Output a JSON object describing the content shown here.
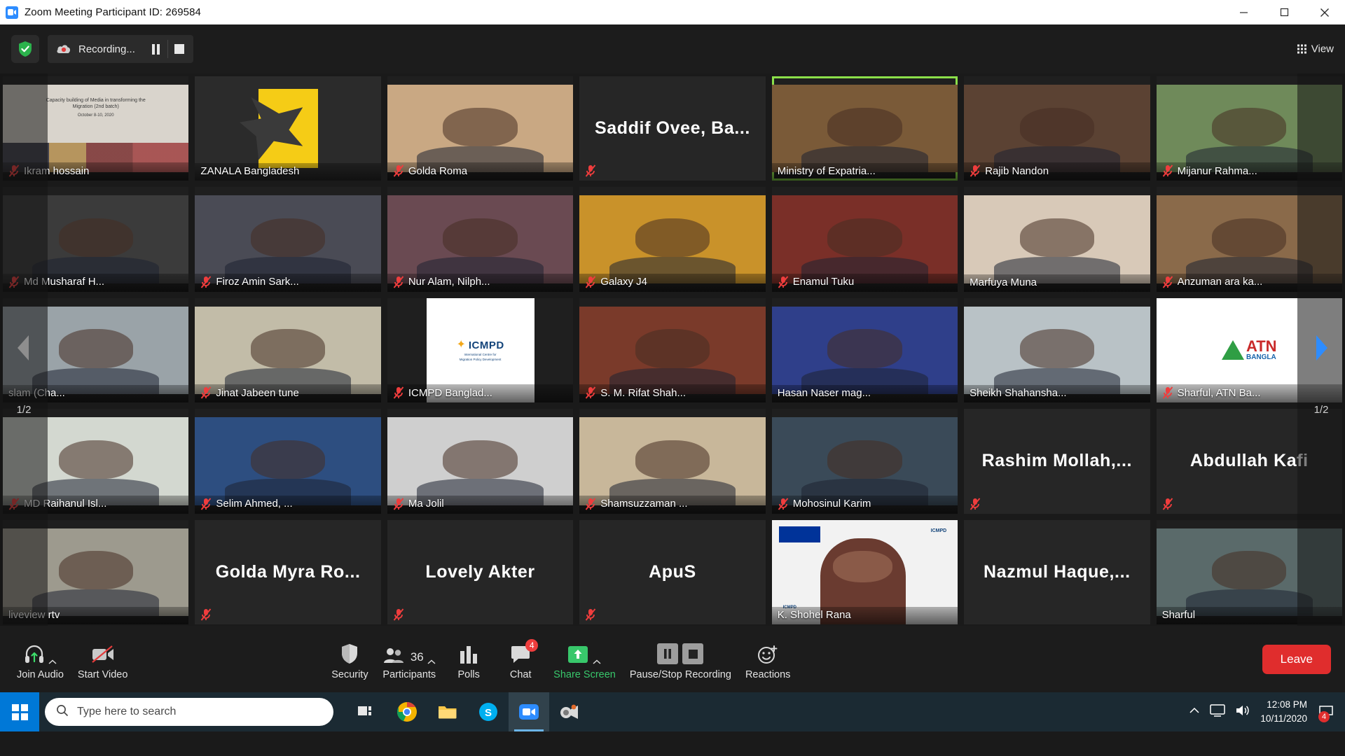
{
  "window": {
    "title": "Zoom Meeting Participant ID: 269584",
    "app_icon": "zoom-camera-icon",
    "minimize_label": "Minimize",
    "maximize_label": "Maximize",
    "close_label": "Close"
  },
  "topbar": {
    "security_shield_icon": "shield-check-icon",
    "recording_label": "Recording...",
    "pause_recording_label": "Pause Recording",
    "stop_recording_label": "Stop Recording",
    "view_label": "View",
    "view_icon": "grid-icon"
  },
  "gallery": {
    "pager_left_label": "Previous page",
    "pager_right_label": "Next page",
    "page_indicator": "1/2",
    "tiles": [
      {
        "name": "Ikram hossain",
        "muted": true,
        "video": true,
        "type": "banner",
        "bg": "#d9d4cc"
      },
      {
        "name": "ZANALA Bangladesh",
        "muted": false,
        "video": true,
        "type": "logo",
        "bg": "#2b2b2b"
      },
      {
        "name": "Golda Roma",
        "muted": true,
        "video": true,
        "type": "person",
        "bg": "#c9a883"
      },
      {
        "name": "Saddif Ovee, Ba...",
        "muted": true,
        "video": false,
        "type": "name",
        "bg": "#262626"
      },
      {
        "name": "Ministry of Expatria...",
        "muted": false,
        "video": true,
        "type": "person",
        "bg": "#7a5a38",
        "active": true
      },
      {
        "name": "Rajib Nandon",
        "muted": true,
        "video": true,
        "type": "person",
        "bg": "#5b4233"
      },
      {
        "name": "Mijanur Rahma...",
        "muted": true,
        "video": true,
        "type": "person",
        "bg": "#6f8a5a"
      },
      {
        "name": "Md Musharaf H...",
        "muted": true,
        "video": true,
        "type": "person",
        "bg": "#3b3b3b"
      },
      {
        "name": "Firoz Amin Sark...",
        "muted": true,
        "video": true,
        "type": "person",
        "bg": "#4a4b55"
      },
      {
        "name": "Nur Alam, Nilph...",
        "muted": true,
        "video": true,
        "type": "person",
        "bg": "#6a4a52"
      },
      {
        "name": "Galaxy J4",
        "muted": true,
        "video": true,
        "type": "person",
        "bg": "#c9922a"
      },
      {
        "name": "Enamul Tuku",
        "muted": true,
        "video": true,
        "type": "person",
        "bg": "#7a2f28"
      },
      {
        "name": "Marfuya Muna",
        "muted": false,
        "video": true,
        "type": "person",
        "bg": "#d8c9b8"
      },
      {
        "name": "Anzuman ara ka...",
        "muted": true,
        "video": true,
        "type": "person",
        "bg": "#8a6a4a"
      },
      {
        "name": "slam (Cha...",
        "muted": false,
        "video": true,
        "type": "person",
        "bg": "#9aa3a8"
      },
      {
        "name": "Jinat Jabeen tune",
        "muted": true,
        "video": true,
        "type": "person",
        "bg": "#c2bca8"
      },
      {
        "name": "ICMPD Banglad...",
        "muted": true,
        "video": true,
        "type": "icmpd",
        "bg": "#2b2b2b"
      },
      {
        "name": "S. M. Rifat Shah...",
        "muted": true,
        "video": true,
        "type": "person",
        "bg": "#7a3a2a"
      },
      {
        "name": "Hasan Naser  mag...",
        "muted": false,
        "video": true,
        "type": "person",
        "bg": "#2f3f8a"
      },
      {
        "name": "Sheikh Shahansha...",
        "muted": false,
        "video": true,
        "type": "person",
        "bg": "#b9c2c6"
      },
      {
        "name": "Sharful, ATN Ba... ",
        "muted": true,
        "video": true,
        "type": "atn",
        "bg": "#ffffff"
      },
      {
        "name": "MD Raihanul Isl...",
        "muted": true,
        "video": true,
        "type": "person",
        "bg": "#d3d8d0"
      },
      {
        "name": "Selim Ahmed, ...",
        "muted": true,
        "video": true,
        "type": "person",
        "bg": "#2d4e80"
      },
      {
        "name": "Ma Jolil",
        "muted": true,
        "video": true,
        "type": "person",
        "bg": "#cfcfcf"
      },
      {
        "name": "Shamsuzzaman ...",
        "muted": true,
        "video": true,
        "type": "person",
        "bg": "#c8b79a"
      },
      {
        "name": "Mohosinul Karim",
        "muted": true,
        "video": true,
        "type": "person",
        "bg": "#3a4a58"
      },
      {
        "name": "Rashim Mollah,...",
        "muted": true,
        "video": false,
        "type": "name",
        "bg": "#262626"
      },
      {
        "name": "Abdullah Kafi",
        "muted": true,
        "video": false,
        "type": "name",
        "bg": "#262626"
      },
      {
        "name": "liveview rtv",
        "muted": false,
        "video": true,
        "type": "person",
        "bg": "#9d9a8e"
      },
      {
        "name": "Golda Myra Ro...",
        "muted": true,
        "video": false,
        "type": "name",
        "bg": "#262626"
      },
      {
        "name": "Lovely Akter",
        "muted": true,
        "video": false,
        "type": "name",
        "bg": "#262626"
      },
      {
        "name": "ApuS",
        "muted": true,
        "video": false,
        "type": "name",
        "bg": "#262626"
      },
      {
        "name": "K. Shohel Rana",
        "muted": false,
        "video": true,
        "type": "icmpdcam",
        "bg": "#e8e8e8"
      },
      {
        "name": "Nazmul Haque,...",
        "muted": false,
        "video": false,
        "type": "name",
        "bg": "#262626"
      },
      {
        "name": "Sharful",
        "muted": false,
        "video": true,
        "type": "person",
        "bg": "#5a6a6a"
      }
    ],
    "banner_tile": {
      "line1": "Capacity building of Media in transforming the",
      "line2": "Migration (2nd batch)",
      "line3": "October 8-10, 2020"
    },
    "icmpd_tile": {
      "title": "ICMPD",
      "subtitle1": "International Centre for",
      "subtitle2": "Migration Policy Development"
    },
    "atn_tile": {
      "title": "ATN",
      "subtitle": "BANGLA"
    }
  },
  "toolbar": {
    "join_audio_label": "Join Audio",
    "join_audio_icon": "headset-icon",
    "start_video_label": "Start Video",
    "start_video_icon": "camera-off-icon",
    "security_label": "Security",
    "security_icon": "shield-icon",
    "participants_label": "Participants",
    "participants_icon": "people-icon",
    "participants_count": "36",
    "polls_label": "Polls",
    "polls_icon": "bar-chart-icon",
    "chat_label": "Chat",
    "chat_icon": "chat-bubble-icon",
    "chat_badge": "4",
    "share_screen_label": "Share Screen",
    "share_screen_icon": "share-arrow-icon",
    "recording_label": "Pause/Stop Recording",
    "pause_icon": "pause-icon",
    "stop_icon": "stop-icon",
    "reactions_label": "Reactions",
    "reactions_icon": "smiley-plus-icon",
    "leave_label": "Leave",
    "accent_green": "#38c76b",
    "accent_red": "#e02d2d"
  },
  "taskbar": {
    "start_label": "Start",
    "search_placeholder": "Type here to search",
    "search_icon": "magnifier-icon",
    "apps": [
      {
        "name": "task-view-icon",
        "label": "Task View"
      },
      {
        "name": "chrome-icon",
        "label": "Google Chrome"
      },
      {
        "name": "explorer-icon",
        "label": "File Explorer"
      },
      {
        "name": "skype-icon",
        "label": "Skype"
      },
      {
        "name": "zoom-icon",
        "label": "Zoom"
      },
      {
        "name": "camtasia-icon",
        "label": "Camtasia"
      }
    ],
    "tray": {
      "expand_icon": "chevron-up-icon",
      "network_icon": "monitor-icon",
      "volume_icon": "speaker-icon",
      "time": "12:08 PM",
      "date": "10/11/2020",
      "notification_count": "4"
    }
  }
}
